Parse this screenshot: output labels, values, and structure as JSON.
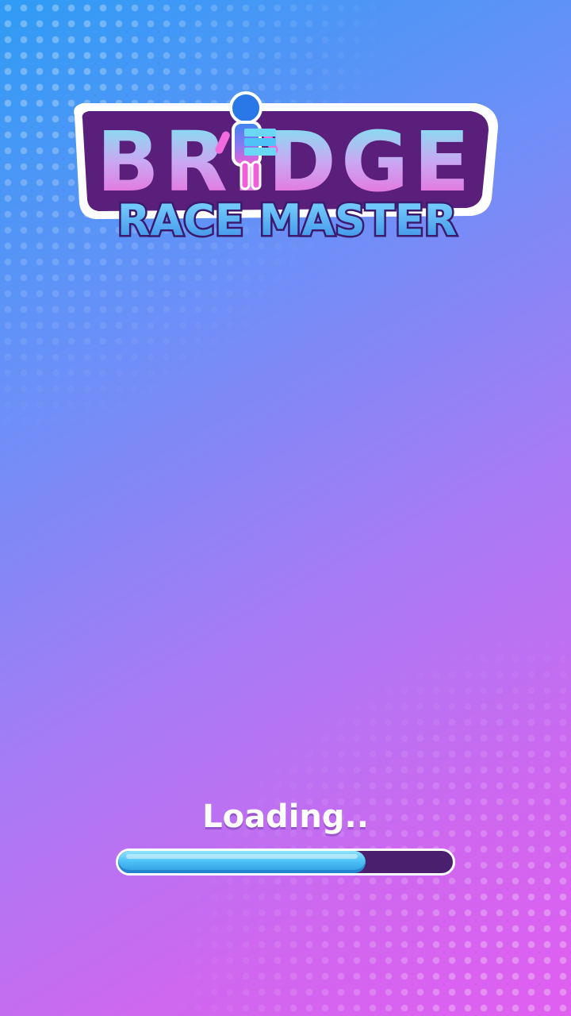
{
  "logo": {
    "title": "BRIDGE",
    "subtitle": "RACE MASTER"
  },
  "loading": {
    "label": "Loading..",
    "progress": 0.74
  },
  "colors": {
    "background_top": "#2f9cf5",
    "background_bottom": "#e05ff0",
    "logo_outline": "#5a1f7a",
    "progress_fill": "#4fc2f7",
    "progress_track": "#4a1f6e"
  }
}
